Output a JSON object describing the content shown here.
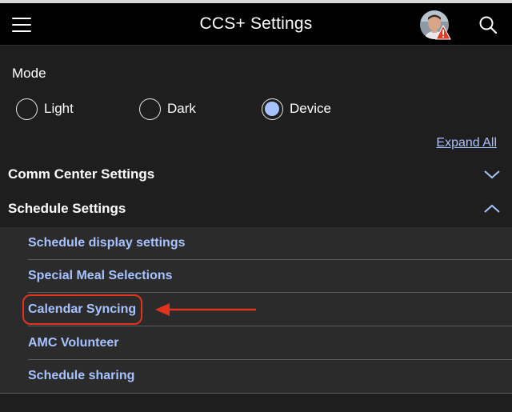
{
  "header": {
    "title": "CCS+ Settings",
    "menu_icon": "hamburger-menu-icon",
    "avatar_icon": "user-avatar",
    "warning_icon": "warning-icon",
    "search_icon": "search-icon"
  },
  "mode": {
    "label": "Mode",
    "options": [
      {
        "label": "Light",
        "selected": false
      },
      {
        "label": "Dark",
        "selected": false
      },
      {
        "label": "Device",
        "selected": true
      }
    ]
  },
  "expand_all": "Expand All",
  "sections": [
    {
      "title": "Comm Center Settings",
      "expanded": false,
      "icon": "chevron-down-icon"
    },
    {
      "title": "Schedule Settings",
      "expanded": true,
      "icon": "chevron-up-icon"
    }
  ],
  "schedule_items": [
    {
      "label": "Schedule display settings"
    },
    {
      "label": "Special Meal Selections"
    },
    {
      "label": "Calendar Syncing"
    },
    {
      "label": "AMC Volunteer"
    },
    {
      "label": "Schedule sharing"
    }
  ],
  "colors": {
    "background": "#1e1e1e",
    "header": "#000000",
    "accent": "#a7c3ff",
    "annotation": "#e3331d",
    "subpanel": "#2b2b2b"
  }
}
